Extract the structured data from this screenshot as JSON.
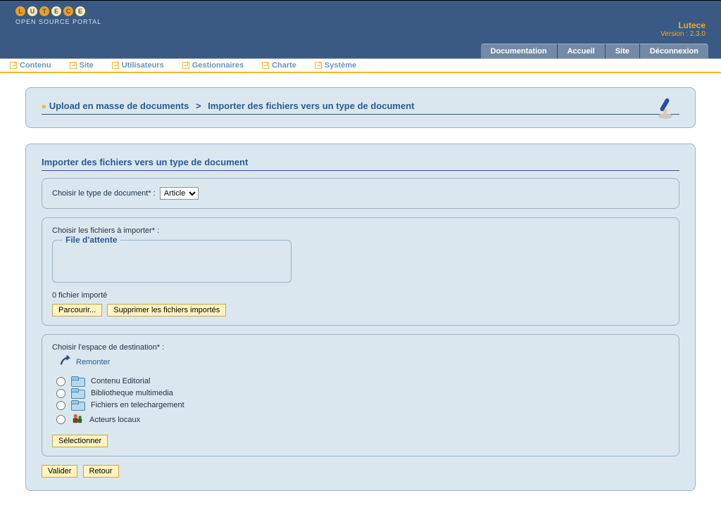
{
  "brand": {
    "name": "Lutece",
    "version": "Version : 2.3.0",
    "portal_tag": "OPEN SOURCE PORTAL",
    "logo_letters": [
      "L",
      "U",
      "T",
      "E",
      "C",
      "E"
    ]
  },
  "top_tabs": [
    "Documentation",
    "Accueil",
    "Site",
    "Déconnexion"
  ],
  "menu": [
    "Contenu",
    "Site",
    "Utilisateurs",
    "Gestionnaires",
    "Charte",
    "Système"
  ],
  "breadcrumb": {
    "a": "Upload en masse de documents",
    "b": "Importer des fichiers vers un type de document"
  },
  "section_title": "Importer des fichiers vers un type de document",
  "type_row": {
    "label": "Choisir le type de document* :",
    "selected": "Article"
  },
  "files_row": {
    "legend": "Choisir les fichiers à importer* :",
    "queue_legend": "File d'attente",
    "counter": "0 fichier importé",
    "browse": "Parcourir...",
    "clear": "Supprimer les fichiers importés"
  },
  "dest_row": {
    "legend": "Choisir l'espace de destination* :",
    "up": "Remonter",
    "select": "Sélectionner",
    "spaces": [
      "Contenu Editorial",
      "Bibliotheque multimedia",
      "Fichiers en telechargement",
      "Acteurs locaux"
    ]
  },
  "footer": {
    "validate": "Valider",
    "back": "Retour"
  }
}
